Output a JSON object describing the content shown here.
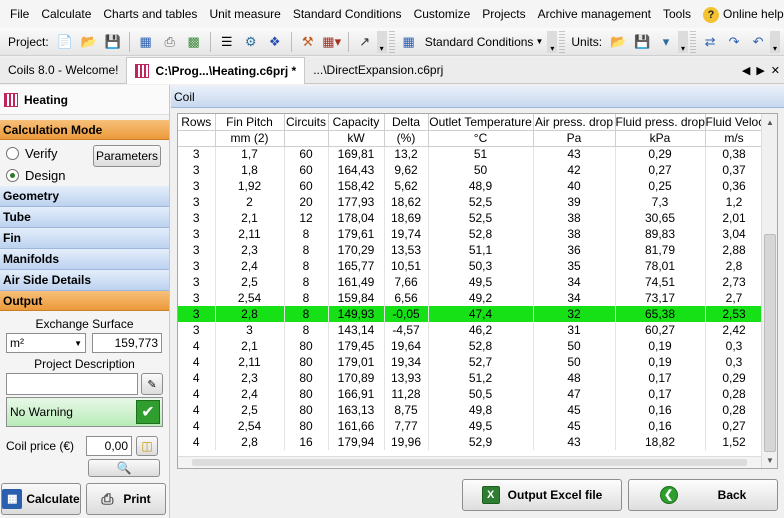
{
  "menu": {
    "file": "File",
    "calculate": "Calculate",
    "charts": "Charts and tables",
    "unit_measure": "Unit measure",
    "standard_conditions": "Standard Conditions",
    "customize": "Customize",
    "projects": "Projects",
    "archive": "Archive management",
    "tools": "Tools",
    "online_help": "Online help"
  },
  "toolbar": {
    "project_label": "Project:",
    "standard_conditions_combo": "Standard Conditions",
    "units_label": "Units:"
  },
  "tabs": [
    {
      "label": "Coils 8.0 - Welcome!"
    },
    {
      "label": "C:\\Prog...\\Heating.c6prj *"
    },
    {
      "label": "...\\DirectExpansion.c6prj"
    }
  ],
  "left": {
    "title": "Heating",
    "calc_mode": "Calculation Mode",
    "verify": "Verify",
    "design": "Design",
    "design_selected": true,
    "parameters_btn": "Parameters",
    "sections": [
      "Geometry",
      "Tube",
      "Fin",
      "Manifolds",
      "Air Side Details"
    ],
    "output": "Output",
    "exchange_surface_label": "Exchange Surface",
    "exchange_unit": "m²",
    "exchange_value": "159,773",
    "project_desc_label": "Project Description",
    "warning_text": "No Warning",
    "coil_price_label": "Coil price (€)",
    "coil_price_value": "0,00",
    "calculate_btn": "Calculate",
    "print_btn": "Print"
  },
  "coil_header": "Coil",
  "table": {
    "headers": [
      "Rows",
      "Fin Pitch",
      "Circuits",
      "Capacity",
      "Delta",
      "Outlet Temperature",
      "Air press. drop",
      "Fluid press. drop",
      "Fluid Velocity"
    ],
    "units": [
      "",
      "mm (2)",
      "",
      "kW",
      "(%)",
      "°C",
      "Pa",
      "kPa",
      "m/s"
    ],
    "highlight_row": 11,
    "rows": [
      [
        "3",
        "1,7",
        "60",
        "169,81",
        "13,2",
        "51",
        "43",
        "0,29",
        "0,38"
      ],
      [
        "3",
        "1,8",
        "60",
        "164,43",
        "9,62",
        "50",
        "42",
        "0,27",
        "0,37"
      ],
      [
        "3",
        "1,92",
        "60",
        "158,42",
        "5,62",
        "48,9",
        "40",
        "0,25",
        "0,36"
      ],
      [
        "3",
        "2",
        "20",
        "177,93",
        "18,62",
        "52,5",
        "39",
        "7,3",
        "1,2"
      ],
      [
        "3",
        "2,1",
        "12",
        "178,04",
        "18,69",
        "52,5",
        "38",
        "30,65",
        "2,01"
      ],
      [
        "3",
        "2,11",
        "8",
        "179,61",
        "19,74",
        "52,8",
        "38",
        "89,83",
        "3,04"
      ],
      [
        "3",
        "2,3",
        "8",
        "170,29",
        "13,53",
        "51,1",
        "36",
        "81,79",
        "2,88"
      ],
      [
        "3",
        "2,4",
        "8",
        "165,77",
        "10,51",
        "50,3",
        "35",
        "78,01",
        "2,8"
      ],
      [
        "3",
        "2,5",
        "8",
        "161,49",
        "7,66",
        "49,5",
        "34",
        "74,51",
        "2,73"
      ],
      [
        "3",
        "2,54",
        "8",
        "159,84",
        "6,56",
        "49,2",
        "34",
        "73,17",
        "2,7"
      ],
      [
        "3",
        "2,8",
        "8",
        "149,93",
        "-0,05",
        "47,4",
        "32",
        "65,38",
        "2,53"
      ],
      [
        "3",
        "3",
        "8",
        "143,14",
        "-4,57",
        "46,2",
        "31",
        "60,27",
        "2,42"
      ],
      [
        "4",
        "2,1",
        "80",
        "179,45",
        "19,64",
        "52,8",
        "50",
        "0,19",
        "0,3"
      ],
      [
        "4",
        "2,11",
        "80",
        "179,01",
        "19,34",
        "52,7",
        "50",
        "0,19",
        "0,3"
      ],
      [
        "4",
        "2,3",
        "80",
        "170,89",
        "13,93",
        "51,2",
        "48",
        "0,17",
        "0,29"
      ],
      [
        "4",
        "2,4",
        "80",
        "166,91",
        "11,28",
        "50,5",
        "47",
        "0,17",
        "0,28"
      ],
      [
        "4",
        "2,5",
        "80",
        "163,13",
        "8,75",
        "49,8",
        "45",
        "0,16",
        "0,28"
      ],
      [
        "4",
        "2,54",
        "80",
        "161,66",
        "7,77",
        "49,5",
        "45",
        "0,16",
        "0,27"
      ],
      [
        "4",
        "2,8",
        "16",
        "179,94",
        "19,96",
        "52,9",
        "43",
        "18,82",
        "1,52"
      ]
    ]
  },
  "buttons": {
    "excel": "Output Excel file",
    "back": "Back"
  }
}
